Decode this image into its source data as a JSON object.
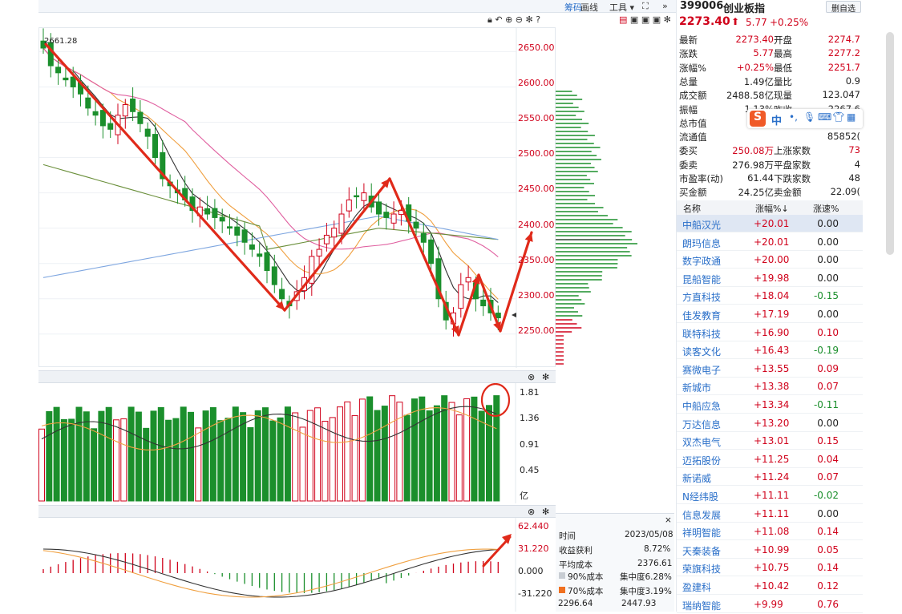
{
  "toolbar": {
    "items": [
      "筹码",
      "画线",
      "工具 ▾"
    ],
    "fullscreen_icon": "fullscreen-icon",
    "more_icon": "double-chevron-icon",
    "chart_icons": [
      "lock-icon",
      "undo-icon",
      "zoom-in-icon",
      "zoom-out-icon",
      "settings-icon",
      "help-icon"
    ],
    "layout_icons": [
      "layout-1-icon",
      "layout-2-icon",
      "layout-3-icon",
      "layout-4-icon",
      "settings-icon"
    ]
  },
  "quote": {
    "code": "399006",
    "name": "创业板指",
    "add_fav": "删自选",
    "price": "2273.40",
    "arrow": "⬆",
    "change": "5.77",
    "change_pct": "+0.25%",
    "rows": [
      {
        "l1": "最新",
        "v1": "2273.40",
        "l2": "开盘",
        "v2": "2274.7"
      },
      {
        "l1": "涨跌",
        "v1": "5.77",
        "l2": "最高",
        "v2": "2277.2"
      },
      {
        "l1": "涨幅%",
        "v1": "+0.25%",
        "l2": "最低",
        "v2": "2251.7"
      },
      {
        "l1": "总量",
        "v1": "1.49亿",
        "l2": "量比",
        "v2": "0.9"
      },
      {
        "l1": "成交额",
        "v1": "2488.58亿",
        "l2": "现量",
        "v2": "123.047"
      },
      {
        "l1": "振幅",
        "v1": "1.13%",
        "l2": "昨收",
        "v2": "2267.6"
      },
      {
        "l1": "总市值",
        "v1": "",
        "l2": "",
        "v2": ""
      },
      {
        "l1": "流通值",
        "v1": "",
        "l2": "",
        "v2": "85852("
      },
      {
        "l1": "委买",
        "v1": "250.08万",
        "l2": "上涨家数",
        "v2": "73"
      },
      {
        "l1": "委卖",
        "v1": "276.98万",
        "l2": "平盘家数",
        "v2": "4"
      },
      {
        "l1": "市盈率(动)",
        "v1": "61.44",
        "l2": "下跌家数",
        "v2": "48"
      },
      {
        "l1": "买金额",
        "v1": "24.25亿",
        "l2": "卖金额",
        "v2": "22.09("
      }
    ]
  },
  "ime_bar": {
    "logo": "S",
    "lang": "中",
    "icons": [
      "punct-icon",
      "mic-icon",
      "keyboard-icon",
      "shirt-icon",
      "grid-icon"
    ]
  },
  "list": {
    "headers": [
      "名称",
      "涨幅%↓",
      "涨速%"
    ],
    "rows": [
      {
        "name": "中船汉光",
        "pct": "+20.01",
        "speed": "0.00"
      },
      {
        "name": "朗玛信息",
        "pct": "+20.01",
        "speed": "0.00"
      },
      {
        "name": "数字政通",
        "pct": "+20.00",
        "speed": "0.00"
      },
      {
        "name": "昆船智能",
        "pct": "+19.98",
        "speed": "0.00"
      },
      {
        "name": "方直科技",
        "pct": "+18.04",
        "speed": "-0.15"
      },
      {
        "name": "佳发教育",
        "pct": "+17.19",
        "speed": "0.00"
      },
      {
        "name": "联特科技",
        "pct": "+16.90",
        "speed": "0.10"
      },
      {
        "name": "读客文化",
        "pct": "+16.43",
        "speed": "-0.19"
      },
      {
        "name": "赛微电子",
        "pct": "+13.55",
        "speed": "0.09"
      },
      {
        "name": "新城市",
        "pct": "+13.38",
        "speed": "0.07"
      },
      {
        "name": "中船应急",
        "pct": "+13.34",
        "speed": "-0.11"
      },
      {
        "name": "万达信息",
        "pct": "+13.20",
        "speed": "0.00"
      },
      {
        "name": "双杰电气",
        "pct": "+13.01",
        "speed": "0.15"
      },
      {
        "name": "迈拓股份",
        "pct": "+11.25",
        "speed": "0.04"
      },
      {
        "name": "新诺威",
        "pct": "+11.24",
        "speed": "0.07"
      },
      {
        "name": "N经纬股",
        "pct": "+11.11",
        "speed": "-0.02"
      },
      {
        "name": "信息发展",
        "pct": "+11.11",
        "speed": "0.00"
      },
      {
        "name": "祥明智能",
        "pct": "+11.08",
        "speed": "0.14"
      },
      {
        "name": "天秦装备",
        "pct": "+10.99",
        "speed": "0.05"
      },
      {
        "name": "荣旗科技",
        "pct": "+10.75",
        "speed": "0.14"
      },
      {
        "name": "盈建科",
        "pct": "+10.42",
        "speed": "0.12"
      },
      {
        "name": "瑞纳智能",
        "pct": "+9.99",
        "speed": "0.76"
      }
    ]
  },
  "main_chart": {
    "high_label": "2661.28",
    "y_labels": [
      "2650.00",
      "2600.00",
      "2550.00",
      "2500.00",
      "2450.00",
      "2400.00",
      "2350.00",
      "2300.00",
      "2250.00"
    ]
  },
  "volume_chart": {
    "y_labels": [
      "1.81",
      "1.36",
      "0.91",
      "0.45"
    ],
    "unit": "亿"
  },
  "macd_chart": {
    "y_labels": [
      "62.440",
      "31.220",
      "0.000",
      "-31.220"
    ]
  },
  "cost_panel": {
    "close": "×",
    "time_label": "时间",
    "time": "2023/05/08",
    "profit_label": "收益获利",
    "profit": "8.72%",
    "avg_label": "平均成本",
    "avg": "2376.61",
    "c90_label": "90%成本",
    "c90_conc": "集中度6.28%",
    "c70_label": "70%成本",
    "c70_conc": "集中度3.19%",
    "low": "2296.64",
    "high": "2447.93"
  },
  "colors": {
    "up": "#d0021b",
    "down": "#1b8f2c",
    "annotation": "#e02a1a",
    "ma1": "#333333",
    "ma2": "#f0a040",
    "ma3": "#e060a0",
    "ma4": "#6a8f3a",
    "ma5": "#7ea6e0"
  }
}
